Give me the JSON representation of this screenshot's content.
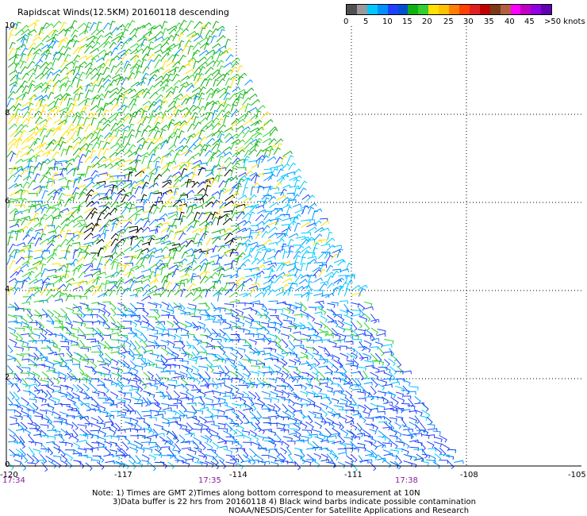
{
  "title": "Rapidscat Winds(12.5KM) 20160118 descending",
  "legend": {
    "colors": [
      "#505050",
      "#9a9a9a",
      "#00c8ff",
      "#0090ff",
      "#2040ff",
      "#0050d0",
      "#10b010",
      "#30d030",
      "#ffe000",
      "#ffc000",
      "#ff8000",
      "#ff4000",
      "#e02020",
      "#c00000",
      "#7a3a1a",
      "#b06040",
      "#ff00ff",
      "#c000c0",
      "#9000e0",
      "#6000b0"
    ],
    "labels": [
      "0",
      "5",
      "10",
      "15",
      "20",
      "25",
      "30",
      "35",
      "40",
      "45",
      ">50 knots"
    ]
  },
  "axes": {
    "lat_labels": [
      "10",
      "8",
      "6",
      "4",
      "2",
      "0"
    ],
    "lon_labels": [
      "-120",
      "-117",
      "-114",
      "-111",
      "-108",
      "-105"
    ],
    "time_labels": [
      "17:34",
      "17:35",
      "17:38"
    ]
  },
  "notes": {
    "line1": "Note: 1) Times are GMT 2)Times along bottom correspond to measurement at 10N",
    "line2": "3)Data buffer is 22 hrs from 20160118 4) Black wind barbs indicate possible contamination",
    "line3": "NOAA/NESDIS/Center for Satellite Applications and Research"
  }
}
